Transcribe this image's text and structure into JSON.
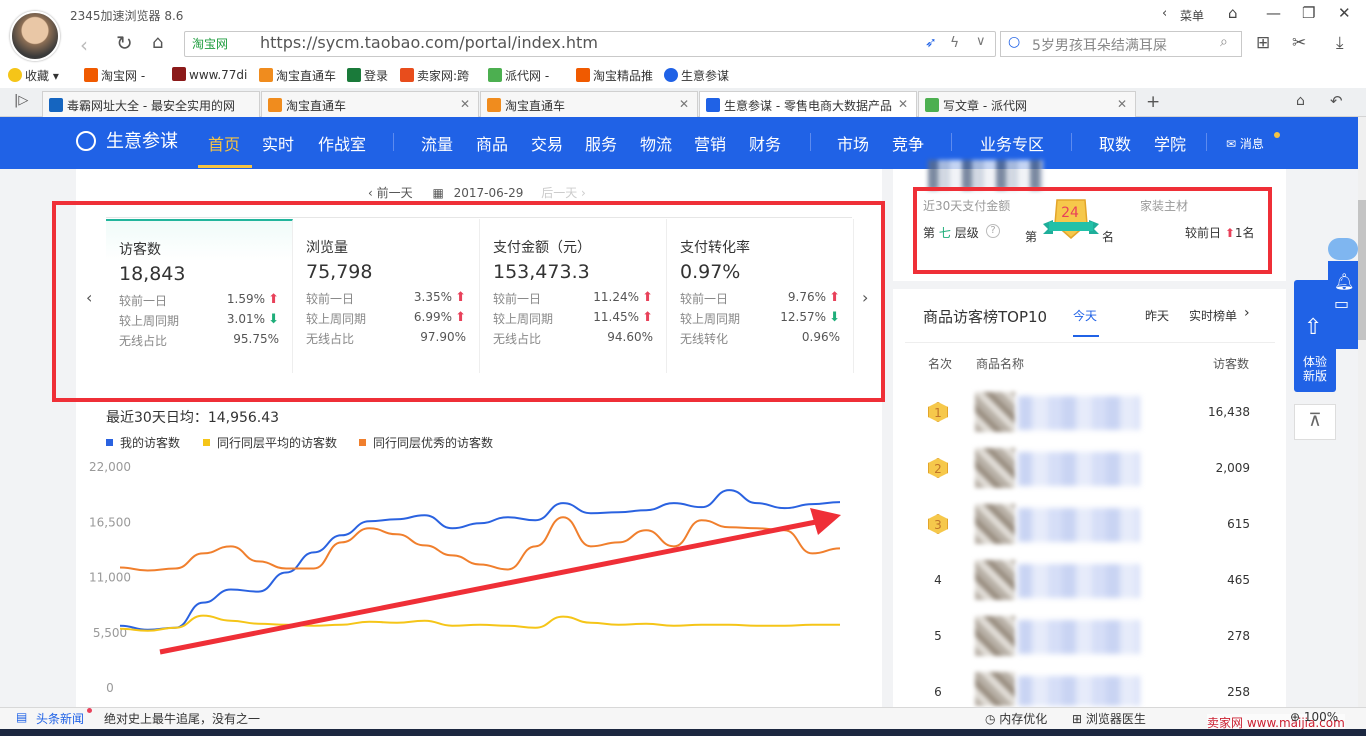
{
  "browser": {
    "title": "2345加速浏览器 8.6",
    "menu_label": "菜单",
    "site_badge": "淘宝网",
    "url": "https://sycm.taobao.com/portal/index.htm",
    "search_placeholder": "5岁男孩耳朵结满耳屎",
    "bookmarks": [
      "收藏",
      "淘宝网 -",
      "www.77di",
      "淘宝直通车",
      "登录",
      "卖家网:跨",
      "派代网 -",
      "淘宝精品推",
      "生意参谋"
    ],
    "tabs": [
      {
        "label": "毒霸网址大全 - 最安全实用的网",
        "icon_color": "#1565c0"
      },
      {
        "label": "淘宝直通车",
        "icon_color": "#f08c1e"
      },
      {
        "label": "淘宝直通车",
        "icon_color": "#f08c1e"
      },
      {
        "label": "生意参谋 - 零售电商大数据产品",
        "icon_color": "#2062e6"
      },
      {
        "label": "写文章 - 派代网",
        "icon_color": "#4caf50"
      }
    ]
  },
  "nav": {
    "brand": "生意参谋",
    "items": [
      "首页",
      "实时",
      "作战室",
      "流量",
      "商品",
      "交易",
      "服务",
      "物流",
      "营销",
      "财务",
      "市场",
      "竞争",
      "业务专区",
      "取数",
      "学院"
    ],
    "message": "消息"
  },
  "date_nav": {
    "prev": "前一天",
    "date": "2017-06-29",
    "next": "后一天"
  },
  "cards": [
    {
      "title": "访客数",
      "value": "18,843",
      "rows": [
        {
          "label": "较前一日",
          "value": "1.59%",
          "dir": "up"
        },
        {
          "label": "较上周同期",
          "value": "3.01%",
          "dir": "down"
        },
        {
          "label": "无线占比",
          "value": "95.75%",
          "dir": ""
        }
      ]
    },
    {
      "title": "浏览量",
      "value": "75,798",
      "rows": [
        {
          "label": "较前一日",
          "value": "3.35%",
          "dir": "up"
        },
        {
          "label": "较上周同期",
          "value": "6.99%",
          "dir": "up"
        },
        {
          "label": "无线占比",
          "value": "97.90%",
          "dir": ""
        }
      ]
    },
    {
      "title": "支付金额（元）",
      "value": "153,473.3",
      "rows": [
        {
          "label": "较前一日",
          "value": "11.24%",
          "dir": "up"
        },
        {
          "label": "较上周同期",
          "value": "11.45%",
          "dir": "up"
        },
        {
          "label": "无线占比",
          "value": "94.60%",
          "dir": ""
        }
      ]
    },
    {
      "title": "支付转化率",
      "value": "0.97%",
      "rows": [
        {
          "label": "较前一日",
          "value": "9.76%",
          "dir": "up"
        },
        {
          "label": "较上周同期",
          "value": "12.57%",
          "dir": "down"
        },
        {
          "label": "无线转化",
          "value": "0.96%",
          "dir": ""
        }
      ]
    }
  ],
  "avg_text": "最近30天日均：14,956.43",
  "chart_data": {
    "type": "line",
    "ylim": [
      0,
      22000
    ],
    "yticks": [
      "22,000",
      "16,500",
      "11,000",
      "5,500",
      "0"
    ],
    "series": [
      {
        "name": "我的访客数",
        "color": "#2a62e0",
        "values": [
          6200,
          5800,
          6000,
          8500,
          9800,
          9600,
          11500,
          13500,
          15200,
          16600,
          16800,
          17200,
          15900,
          16400,
          17000,
          16700,
          18400,
          17400,
          17500,
          17700,
          18400,
          18000,
          19700,
          18400,
          17900,
          18300,
          18500
        ]
      },
      {
        "name": "同行同层平均的访客数",
        "color": "#f5c518",
        "values": [
          5900,
          5700,
          6000,
          7200,
          6700,
          6400,
          6300,
          6200,
          6300,
          6600,
          6500,
          6700,
          6200,
          6300,
          6200,
          6000,
          7100,
          6500,
          6300,
          6400,
          6200,
          6300,
          6300,
          6200,
          6200,
          6300,
          6300
        ]
      },
      {
        "name": "同行同层优秀的访客数",
        "color": "#f07f2d",
        "values": [
          12000,
          11700,
          11900,
          13400,
          14100,
          12600,
          11900,
          11900,
          14500,
          15900,
          15300,
          14200,
          13200,
          12300,
          11800,
          14100,
          17000,
          14100,
          14500,
          15700,
          14100,
          16700,
          16000,
          15900,
          15700,
          13400,
          13900
        ]
      }
    ]
  },
  "rank_panel": {
    "title": "近30天支付金额",
    "category": "家装主材",
    "tier_pre": "第",
    "tier_num": "七",
    "tier_post": "层级",
    "help": "?",
    "rank_pre": "第",
    "rank": "24",
    "rank_post": "名",
    "change": "较前日",
    "change_value": "1名"
  },
  "top10": {
    "title": "商品访客榜TOP10",
    "tabs": [
      "今天",
      "昨天",
      "实时榜单"
    ],
    "headers": [
      "名次",
      "商品名称",
      "访客数"
    ],
    "rows": [
      {
        "rank": "1",
        "visitors": "16,438"
      },
      {
        "rank": "2",
        "visitors": "2,009"
      },
      {
        "rank": "3",
        "visitors": "615"
      },
      {
        "rank": "4",
        "visitors": "465"
      },
      {
        "rank": "5",
        "visitors": "278"
      },
      {
        "rank": "6",
        "visitors": "258"
      }
    ]
  },
  "float": {
    "experience": "体验新版"
  },
  "status": {
    "news_label": "头条新闻",
    "news_text": "绝对史上最牛追尾，没有之一",
    "memory": "内存优化",
    "history": "浏览器医生",
    "zoom": "100%",
    "watermark": "卖家网 www.maijia.com"
  }
}
